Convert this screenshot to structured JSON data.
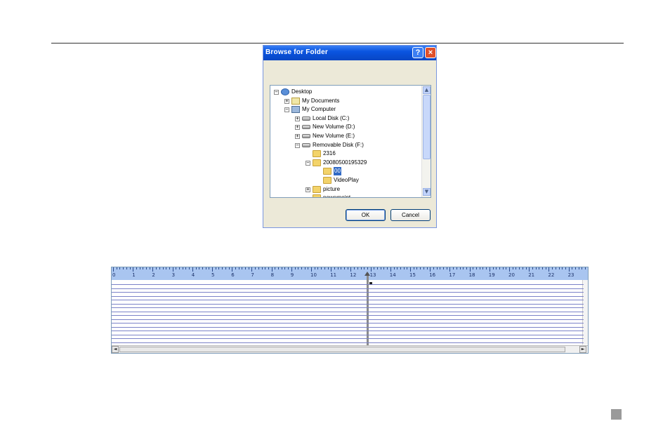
{
  "dialog": {
    "title": "Browse for Folder",
    "help_label": "?",
    "close_label": "×",
    "ok_label": "OK",
    "cancel_label": "Cancel",
    "tree": [
      {
        "label": "Desktop",
        "icon": "desktop-icon",
        "expander": "−",
        "level": 0
      },
      {
        "label": "My Documents",
        "icon": "documents-folder-icon",
        "expander": "+",
        "level": 1
      },
      {
        "label": "My Computer",
        "icon": "computer-icon",
        "expander": "−",
        "level": 1
      },
      {
        "label": "Local Disk (C:)",
        "icon": "drive-icon",
        "expander": "+",
        "level": 2
      },
      {
        "label": "New Volume (D:)",
        "icon": "drive-icon",
        "expander": "+",
        "level": 2
      },
      {
        "label": "New Volume (E:)",
        "icon": "drive-icon",
        "expander": "+",
        "level": 2
      },
      {
        "label": "Removable Disk (F:)",
        "icon": "drive-icon",
        "expander": "−",
        "level": 2
      },
      {
        "label": "2316",
        "icon": "folder-icon",
        "expander": "",
        "level": 3
      },
      {
        "label": "20080500195329",
        "icon": "folder-icon",
        "expander": "−",
        "level": 3
      },
      {
        "label": "00",
        "icon": "open-folder-icon",
        "expander": "",
        "level": 4,
        "selected": true
      },
      {
        "label": "VideoPlay",
        "icon": "folder-icon",
        "expander": "",
        "level": 4
      },
      {
        "label": "picture",
        "icon": "folder-icon",
        "expander": "+",
        "level": 3
      },
      {
        "label": "powerpoint",
        "icon": "folder-icon",
        "expander": "",
        "level": 3
      }
    ],
    "scroll_up": "▲",
    "scroll_down": "▼"
  },
  "timeline": {
    "hours": [
      "0",
      "1",
      "2",
      "3",
      "4",
      "5",
      "6",
      "7",
      "8",
      "9",
      "10",
      "11",
      "12",
      "13",
      "14",
      "15",
      "16",
      "17",
      "18",
      "19",
      "20",
      "21",
      "22",
      "23"
    ],
    "row_count": 16,
    "cursor_hour": 13,
    "scroll_left": "◄",
    "scroll_right": "►"
  },
  "colors": {
    "titlebar": "#0a54e0",
    "selection": "#316ac5",
    "ruler": "#a9c5f0",
    "row_line": "#7b82c8"
  }
}
